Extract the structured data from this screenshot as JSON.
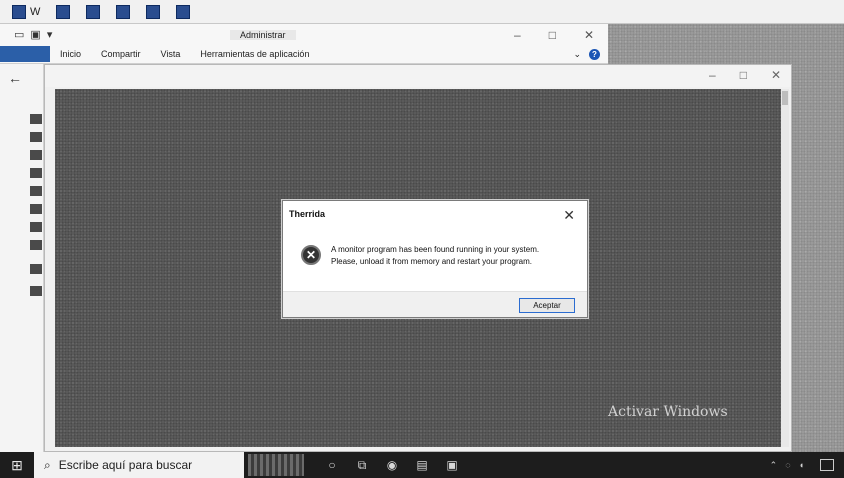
{
  "tabs": [
    {
      "label": "W"
    },
    {
      "label": ""
    },
    {
      "label": ""
    },
    {
      "label": ""
    },
    {
      "label": ""
    },
    {
      "label": ""
    }
  ],
  "explorer": {
    "title": "Administrar",
    "ribbon": {
      "items": [
        "Inicio",
        "Compartir",
        "Vista",
        "Herramientas de aplicación"
      ]
    },
    "controls": {
      "minimize": "–",
      "maximize": "□",
      "close": "✕"
    }
  },
  "viewer": {
    "back": "←",
    "controls": {
      "minimize": "–",
      "maximize": "□",
      "close": "✕"
    }
  },
  "dialog": {
    "title": "Therrida",
    "close": "✕",
    "message_line1": "A monitor program has been found running in your system.",
    "message_line2": "Please, unload it from memory and restart your program.",
    "ok_button": "Aceptar"
  },
  "watermark": {
    "title": "Activar Windows"
  },
  "taskbar": {
    "search_placeholder": "Escribe aquí para buscar"
  },
  "colors": {
    "taskbar": "#1d1d1d",
    "dialog_focus": "#2b6cd0",
    "ribbon_file": "#2b5fa8"
  }
}
